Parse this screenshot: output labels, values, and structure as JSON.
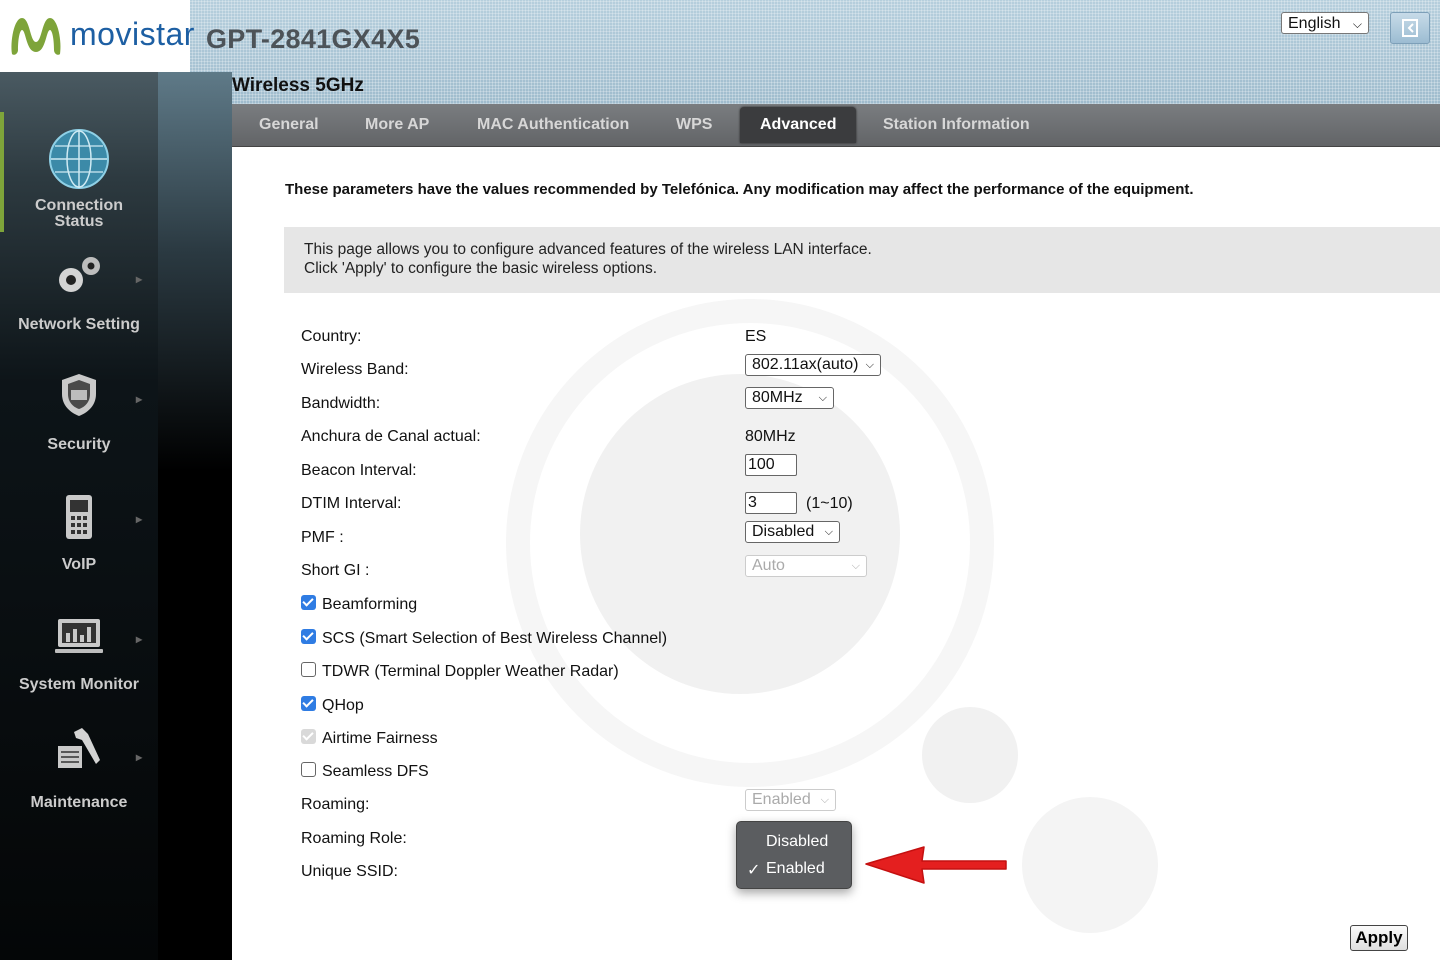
{
  "header": {
    "brand": "movistar",
    "model": "GPT-2841GX4X5",
    "language": "English",
    "page_title": "Wireless 5GHz"
  },
  "sidebar": {
    "items": [
      {
        "label_line1": "Connection",
        "label_line2": "Status",
        "icon": "globe-icon"
      },
      {
        "label": "Network Setting",
        "icon": "gears-icon"
      },
      {
        "label": "Security",
        "icon": "shield-icon"
      },
      {
        "label": "VoIP",
        "icon": "phone-icon"
      },
      {
        "label": "System Monitor",
        "icon": "monitor-chart-icon"
      },
      {
        "label": "Maintenance",
        "icon": "wrench-icon"
      }
    ]
  },
  "tabs": [
    {
      "label": "General"
    },
    {
      "label": "More AP"
    },
    {
      "label": "MAC Authentication"
    },
    {
      "label": "WPS"
    },
    {
      "label": "Advanced",
      "active": true
    },
    {
      "label": "Station Information"
    }
  ],
  "content": {
    "warning": "These parameters have the values recommended by Telefónica. Any modification may affect the performance of the equipment.",
    "info_line1": "This page allows you to configure advanced features of the wireless LAN interface.",
    "info_line2": "Click 'Apply' to configure the basic wireless options.",
    "fields": {
      "country_label": "Country:",
      "country_value": "ES",
      "band_label": "Wireless Band:",
      "band_value": "802.11ax(auto)",
      "bandwidth_label": "Bandwidth:",
      "bandwidth_value": "80MHz",
      "channel_width_label": "Anchura de Canal actual:",
      "channel_width_value": "80MHz",
      "beacon_label": "Beacon Interval:",
      "beacon_value": "100",
      "dtim_label": "DTIM Interval:",
      "dtim_value": "3",
      "dtim_range": "(1~10)",
      "pmf_label": "PMF :",
      "pmf_value": "Disabled",
      "short_gi_label": "Short GI :",
      "short_gi_value": "Auto",
      "roaming_label": "Roaming:",
      "roaming_value": "Enabled",
      "roaming_role_label": "Roaming Role:",
      "unique_ssid_label": "Unique SSID:"
    },
    "checkboxes": [
      {
        "label": "Beamforming",
        "checked": true
      },
      {
        "label": "SCS (Smart Selection of Best Wireless Channel)",
        "checked": true
      },
      {
        "label": "TDWR (Terminal Doppler Weather Radar)",
        "checked": false
      },
      {
        "label": "QHop",
        "checked": true
      },
      {
        "label": "Airtime Fairness",
        "checked": true,
        "disabled": true
      },
      {
        "label": "Seamless DFS",
        "checked": false
      }
    ],
    "dropdown": {
      "options": [
        "Disabled",
        "Enabled"
      ],
      "selected": "Enabled"
    },
    "apply_label": "Apply"
  },
  "colors": {
    "brand_blue": "#1d5fa3",
    "brand_green": "#7ea43a",
    "checkbox_blue": "#2f7ce3",
    "annotation_red": "#e41f1f",
    "tab_bar": "#6e7073",
    "active_tab": "#3b3c3e"
  }
}
